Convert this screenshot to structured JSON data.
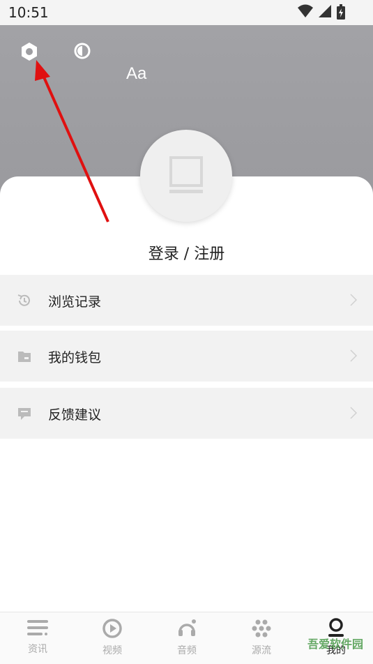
{
  "status_bar": {
    "time": "10:51"
  },
  "header": {
    "font_size_label": "Aa",
    "icons": [
      "gear-icon",
      "contrast-icon"
    ]
  },
  "profile": {
    "login_label": "登录 / 注册"
  },
  "menu": [
    {
      "label": "浏览记录",
      "icon": "history-icon"
    },
    {
      "label": "我的钱包",
      "icon": "wallet-icon"
    },
    {
      "label": "反馈建议",
      "icon": "feedback-icon"
    }
  ],
  "tabs": [
    {
      "label": "资讯",
      "icon": "news-icon"
    },
    {
      "label": "视频",
      "icon": "video-icon"
    },
    {
      "label": "音频",
      "icon": "audio-icon"
    },
    {
      "label": "源流",
      "icon": "source-icon"
    },
    {
      "label": "我的",
      "icon": "profile-icon",
      "active": true
    }
  ],
  "watermark": "吾爱软件园",
  "colors": {
    "header_bg": "#9e9ea2",
    "arrow": "#e01010",
    "menu_bg": "#f2f2f2"
  }
}
